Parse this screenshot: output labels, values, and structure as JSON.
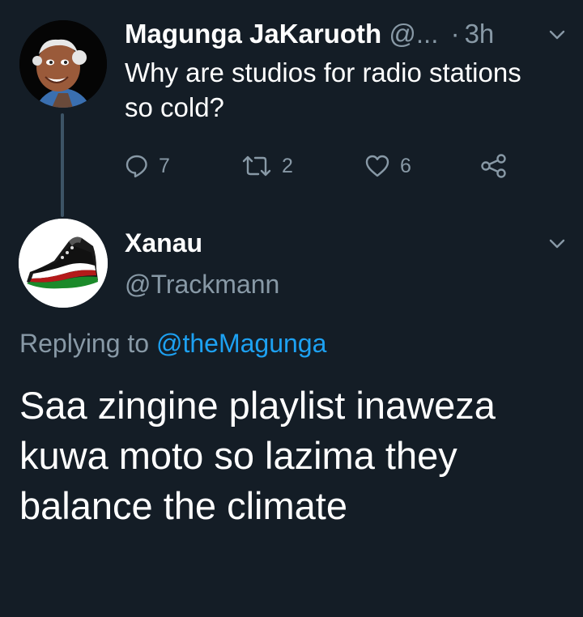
{
  "parent_tweet": {
    "author_name": "Magunga JaKaruoth",
    "author_handle": "@...",
    "separator": "·",
    "time": "3h",
    "text": "Why are studios for radio stations so cold?",
    "actions": {
      "reply_count": "7",
      "retweet_count": "2",
      "like_count": "6"
    }
  },
  "reply_tweet": {
    "author_name": "Xanau",
    "author_handle": "@Trackmann",
    "replying_prefix": "Replying to",
    "replying_mention": "@theMagunga",
    "text": "Saa zingine playlist inaweza kuwa moto so lazima they balance the climate"
  },
  "icons": {
    "reply": "speech-bubble-icon",
    "retweet": "retweet-icon",
    "like": "heart-icon",
    "share": "share-icon",
    "menu": "chevron-down-icon"
  },
  "colors": {
    "background": "#141d26",
    "text_primary": "#ffffff",
    "text_secondary": "#8899a6",
    "link": "#1da1f2"
  }
}
